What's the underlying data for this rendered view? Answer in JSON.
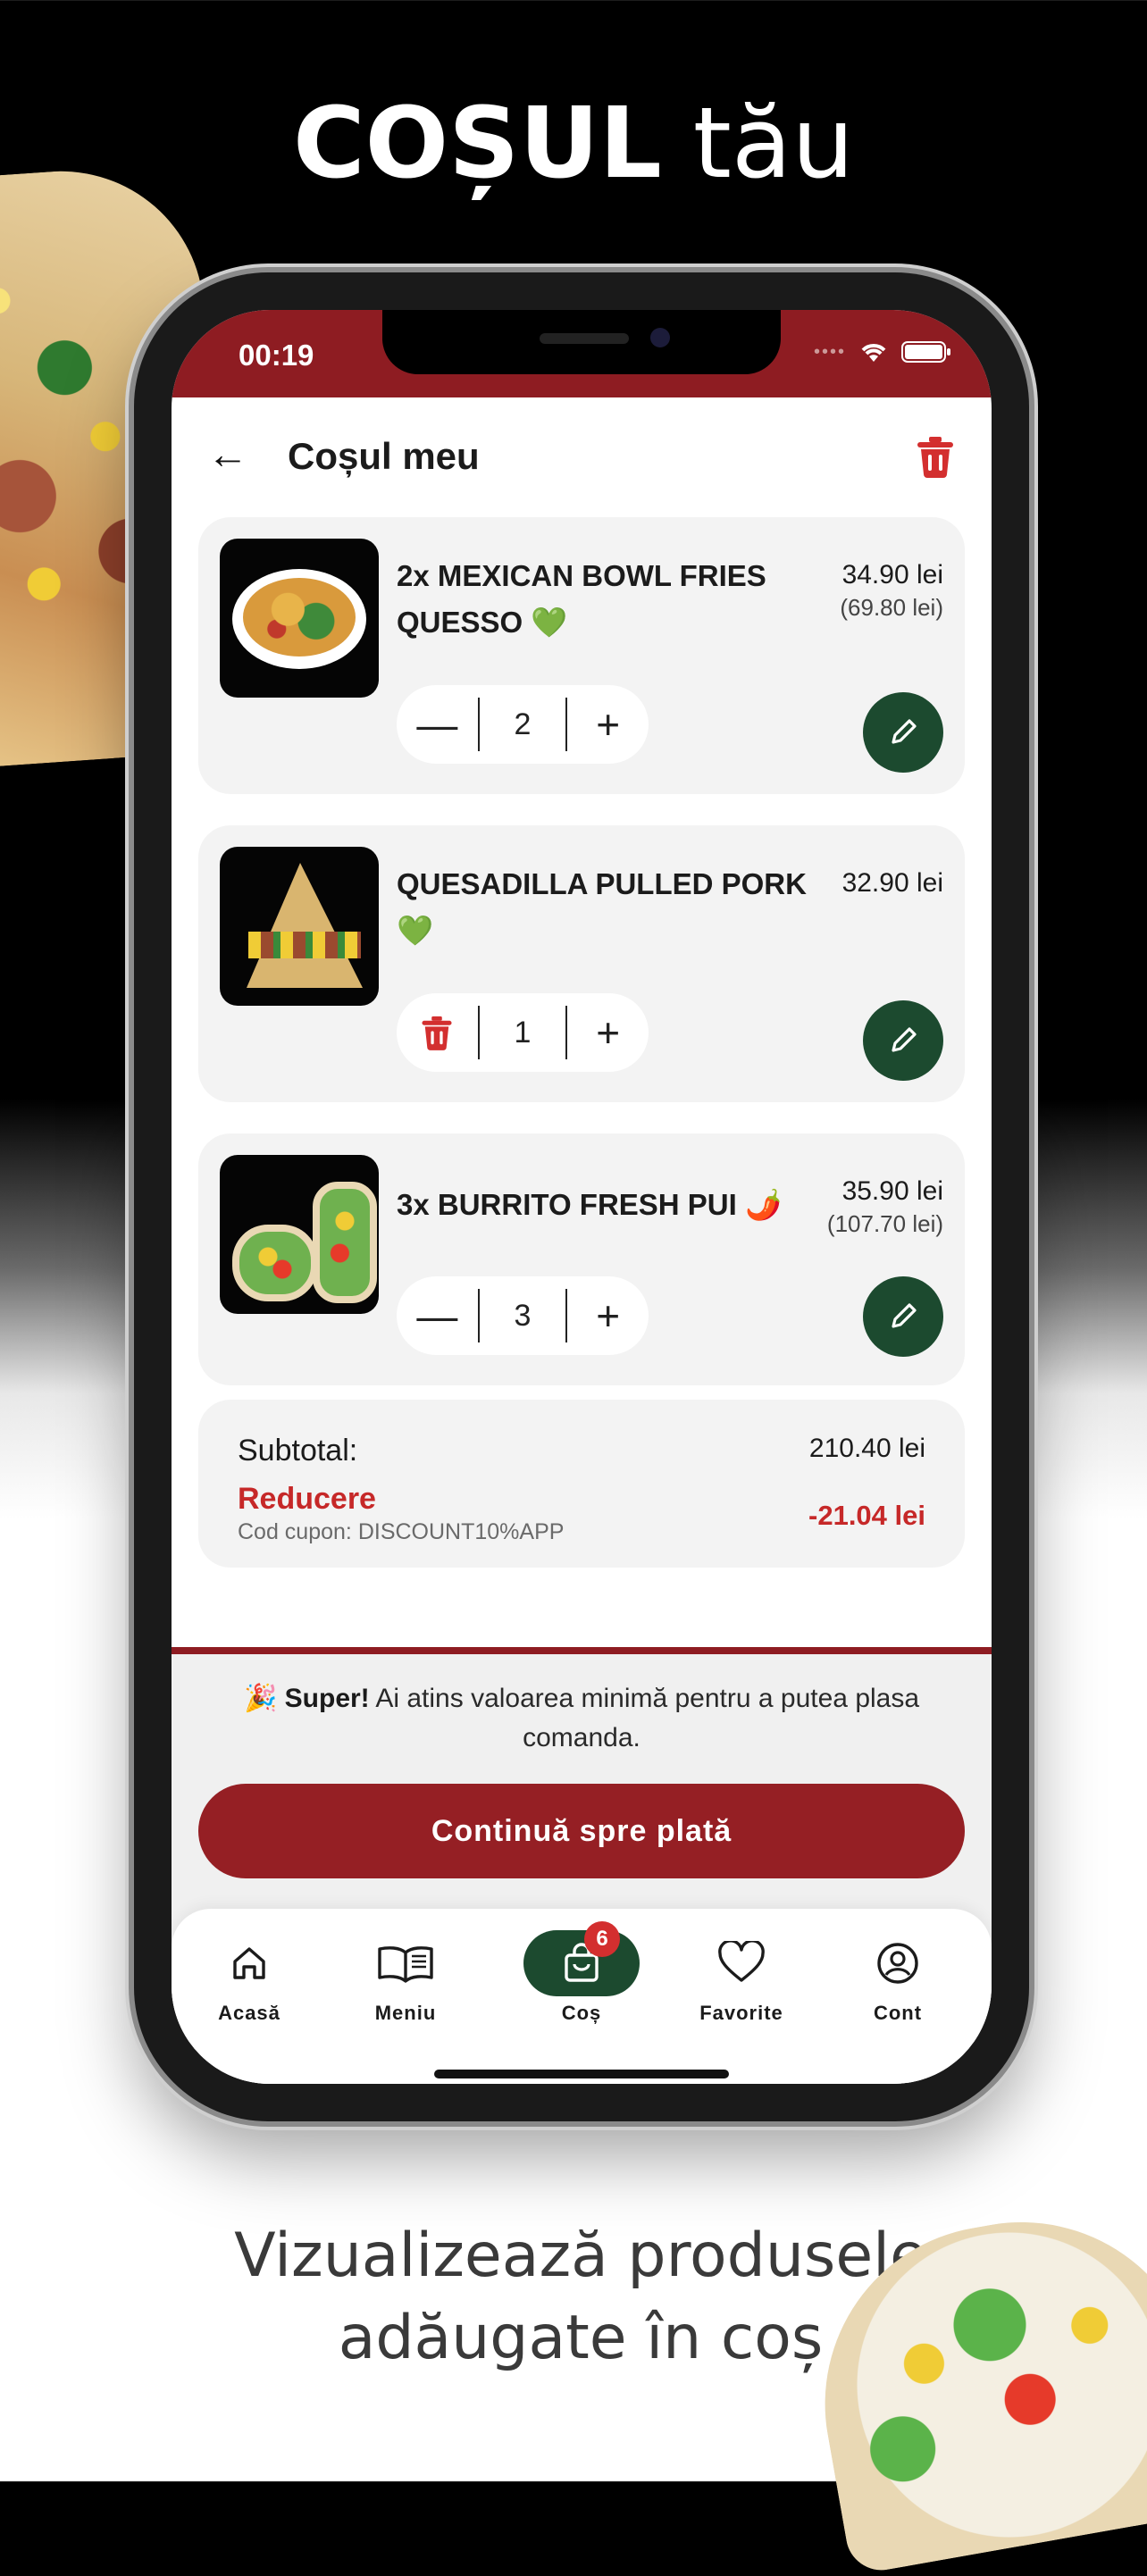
{
  "headline": {
    "bold": "COȘUL",
    "rest": "tău"
  },
  "tagline": {
    "line1": "Vizualizează produsele",
    "line2": "adăugate în coș"
  },
  "status_bar": {
    "time": "00:19"
  },
  "header": {
    "title": "Coșul meu"
  },
  "cart_items": [
    {
      "qty_prefix": "2x",
      "name": "MEXICAN BOWL FRIES QUESSO",
      "emoji": "💚",
      "price": "34.90 lei",
      "total": "(69.80 lei)",
      "quantity": "2"
    },
    {
      "qty_prefix": "",
      "name": "QUESADILLA PULLED PORK",
      "emoji": "💚",
      "price": "32.90 lei",
      "total": "",
      "quantity": "1"
    },
    {
      "qty_prefix": "3x",
      "name": "BURRITO FRESH PUI",
      "emoji": "🌶️",
      "price": "35.90 lei",
      "total": "(107.70 lei)",
      "quantity": "3"
    }
  ],
  "summary": {
    "subtotal_label": "Subtotal:",
    "subtotal_value": "210.40 lei",
    "discount_label": "Reducere",
    "coupon_text": "Cod cupon: DISCOUNT10%APP",
    "discount_value": "-21.04 lei"
  },
  "notice": {
    "emoji": "🎉",
    "bold": "Super!",
    "text": " Ai atins valoarea minimă pentru a putea plasa comanda."
  },
  "cta": {
    "label": "Continuă spre plată"
  },
  "tabbar": {
    "home": "Acasă",
    "menu": "Meniu",
    "cart": "Coș",
    "cart_badge": "6",
    "favorites": "Favorite",
    "account": "Cont"
  },
  "colors": {
    "brand_red": "#951f24",
    "accent_green": "#1c4a2f",
    "discount_red": "#c62828"
  }
}
